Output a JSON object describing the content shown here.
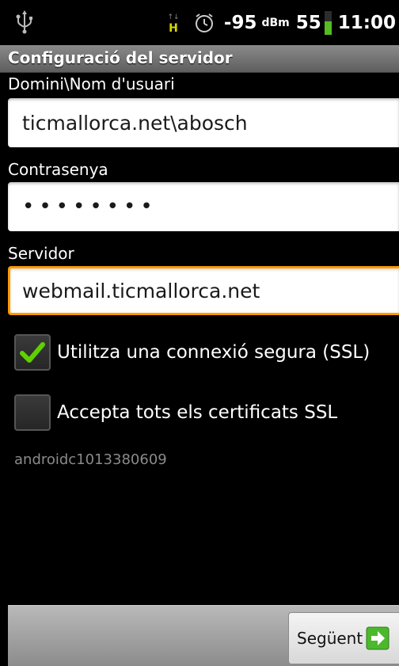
{
  "status_bar": {
    "icons": [
      "usb-icon",
      "hsdpa-icon",
      "alarm-icon",
      "battery-icon"
    ],
    "signal_value": "-95",
    "signal_unit": "dBm",
    "battery_level": "55",
    "battery_fraction": 0.55,
    "time": "11:00"
  },
  "title_bar": {
    "title": "Configuració del servidor"
  },
  "form": {
    "username_label": "Domini\\Nom d'usuari",
    "username_value": "ticmallorca.net\\abosch",
    "password_label": "Contrasenya",
    "password_mask": "••••••••",
    "server_label": "Servidor",
    "server_value": "webmail.ticmallorca.net",
    "ssl_label": "Utilitza una connexió segura (SSL)",
    "ssl_checked": true,
    "accept_all_label": "Accepta tots els certificats SSL",
    "accept_all_checked": false,
    "account_id": "androidc1013380609"
  },
  "bottom_bar": {
    "next_label": "Següent",
    "next_icon": "arrow-right-icon"
  },
  "colors": {
    "focus_border": "#ff9a00",
    "check_green": "#5fd000",
    "battery_green": "#55bb22",
    "next_icon_green": "#4cb82c"
  }
}
